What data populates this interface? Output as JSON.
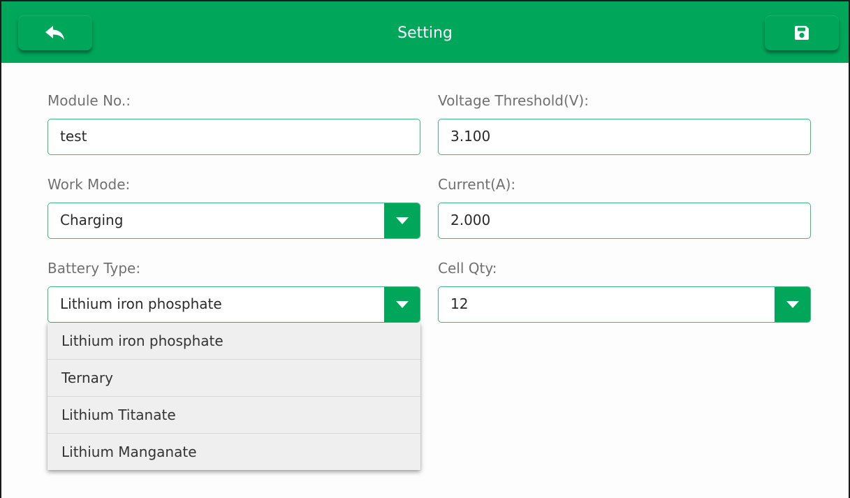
{
  "header": {
    "title": "Setting",
    "back_icon": "reply-arrow-icon",
    "save_icon": "floppy-disk-icon",
    "color": "#00a65a"
  },
  "form": {
    "module_no": {
      "label": "Module No.:",
      "value": "test"
    },
    "voltage_threshold": {
      "label": "Voltage Threshold(V):",
      "value": "3.100"
    },
    "work_mode": {
      "label": "Work Mode:",
      "value": "Charging"
    },
    "current": {
      "label": "Current(A):",
      "value": "2.000"
    },
    "battery_type": {
      "label": "Battery Type:",
      "value": "Lithium iron phosphate"
    },
    "cell_qty": {
      "label": "Cell Qty:",
      "value": "12"
    }
  },
  "battery_dropdown": {
    "options": [
      "Lithium iron phosphate",
      "Ternary",
      "Lithium Titanate",
      "Lithium Manganate"
    ]
  },
  "colors": {
    "accent": "#00a65a",
    "border": "#3dbb7c",
    "label": "#707070",
    "dropdown_bg": "#efefef"
  }
}
